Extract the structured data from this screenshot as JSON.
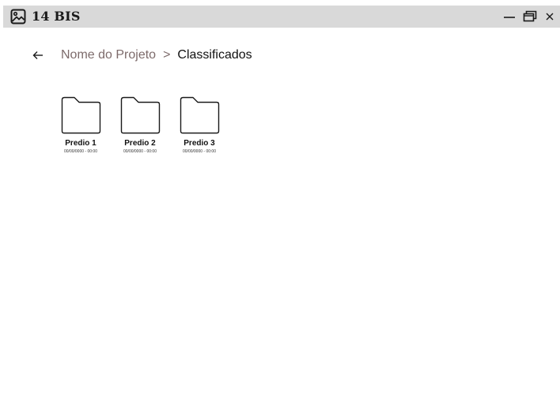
{
  "window": {
    "title": "14 BIS",
    "icon": "image-icon",
    "controls": {
      "minimize": "—",
      "maximize": "restore-icon",
      "close": "✕"
    }
  },
  "breadcrumb": {
    "back_icon": "arrow-left-icon",
    "parent": "Nome do Projeto",
    "separator": ">",
    "current": "Classificados"
  },
  "folders": [
    {
      "name": "Predio 1",
      "date": "00/00/0000 - 00:00"
    },
    {
      "name": "Predio 2",
      "date": "00/00/0000 - 00:00"
    },
    {
      "name": "Predio 3",
      "date": "00/00/0000 - 00:00"
    }
  ],
  "colors": {
    "titlebar_bg": "#d9d9d9",
    "breadcrumb_parent": "#7d6b6b",
    "text": "#111111"
  }
}
